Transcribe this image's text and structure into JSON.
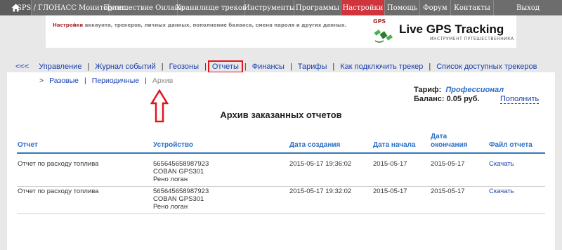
{
  "topnav": {
    "items": [
      {
        "label": "GPS / ГЛОНАСС Мониторинг"
      },
      {
        "label": "Путешествие Онлайн"
      },
      {
        "label": "Хранилище треков"
      },
      {
        "label": "Инструменты"
      },
      {
        "label": "Программы"
      },
      {
        "label": "Настройки"
      },
      {
        "label": "Помощь"
      },
      {
        "label": "Форум"
      },
      {
        "label": "Контакты"
      },
      {
        "label": "Выход"
      }
    ],
    "active": "Настройки"
  },
  "banner": {
    "note_bold": "Настройки",
    "note_rest": " аккаунта, трекеров, личных данных, пополнение баланса, смена пароля и других данных.",
    "logo_tag": "GPS",
    "logo_title": "Live GPS Tracking",
    "logo_subtitle": "ИНСТРУМЕНТ ПУТЕШЕСТВЕННИКА"
  },
  "subnav": {
    "back": "<<<",
    "items": [
      "Управление",
      "Журнал событий",
      "Геозоны",
      "Отчеты",
      "Финансы",
      "Тарифы",
      "Как подключить трекер",
      "Список доступных трекеров"
    ],
    "highlighted": "Отчеты"
  },
  "tabs": {
    "marker": ">",
    "items": [
      "Разовые",
      "Периодичные",
      "Архив"
    ],
    "current": "Архив"
  },
  "account": {
    "tariff_label": "Тариф:",
    "tariff_value": "Профессионал",
    "balance_label": "Баланс:",
    "balance_value": "0.05 руб.",
    "topup": "Пополнить"
  },
  "page": {
    "heading": "Архив заказанных отчетов"
  },
  "table": {
    "headers": [
      "Отчет",
      "Устройство",
      "Дата создания",
      "Дата начала",
      "Дата окончания",
      "Файл отчета"
    ],
    "header_date_end_lines": [
      "Дата",
      "окончания"
    ],
    "rows": [
      {
        "report": "Отчет по расходу топлива",
        "device_id": "565645658987923",
        "device_model": "COBAN GPS301",
        "device_name": "Рено логан",
        "created": "2015-05-17 19:36:02",
        "start": "2015-05-17",
        "end": "2015-05-17",
        "file": "Скачать"
      },
      {
        "report": "Отчет по расходу топлива",
        "device_id": "565645658987923",
        "device_model": "COBAN GPS301",
        "device_name": "Рено логан",
        "created": "2015-05-17 19:32:02",
        "start": "2015-05-17",
        "end": "2015-05-17",
        "file": "Скачать"
      }
    ]
  },
  "colors": {
    "accent": "#d0343c",
    "link": "#1a3fae",
    "header": "#2c6fc8",
    "highlight": "#e0161c"
  }
}
